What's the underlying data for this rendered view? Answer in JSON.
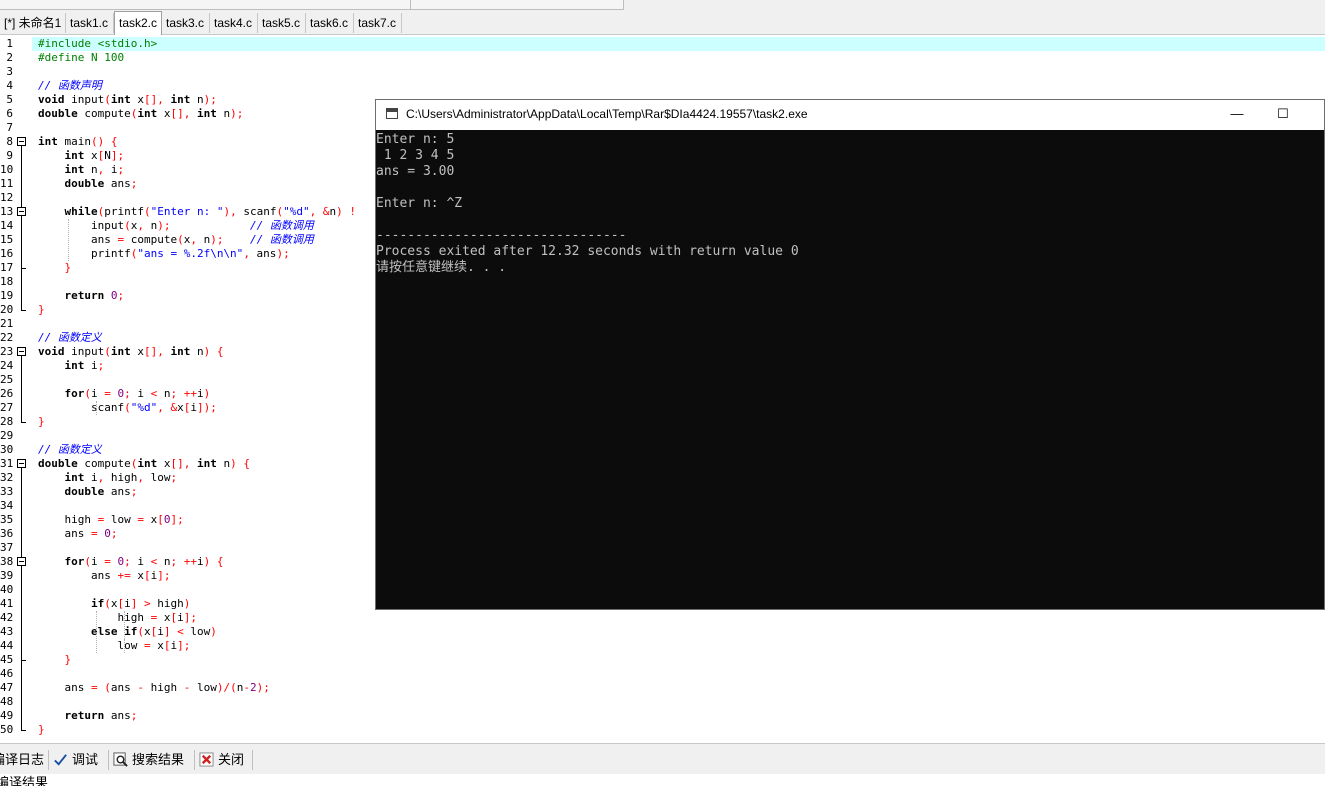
{
  "tabs": [
    "[*] 未命名1",
    "task1.c",
    "task2.c",
    "task3.c",
    "task4.c",
    "task5.c",
    "task6.c",
    "task7.c"
  ],
  "active_tab": "task2.c",
  "colors": {
    "accent_line": "#ccffff",
    "preprocessor": "#008000",
    "string": "#0000ff",
    "number": "#800080",
    "comment": "#0000ff",
    "symbol": "#ff0000"
  },
  "code": [
    "#include <stdio.h>",
    "#define N 100",
    "",
    "// 函数声明",
    "void input(int x[], int n);",
    "double compute(int x[], int n);",
    "",
    "int main() {",
    "    int x[N];",
    "    int n, i;",
    "    double ans;",
    "",
    "    while(printf(\"Enter n: \"), scanf(\"%d\", &n) !",
    "        input(x, n);            // 函数调用",
    "        ans = compute(x, n);    // 函数调用",
    "        printf(\"ans = %.2f\\n\\n\", ans);",
    "    }",
    "",
    "    return 0;",
    "}",
    "",
    "// 函数定义",
    "void input(int x[], int n) {",
    "    int i;",
    "",
    "    for(i = 0; i < n; ++i)",
    "        scanf(\"%d\", &x[i]);",
    "}",
    "",
    "// 函数定义",
    "double compute(int x[], int n) {",
    "    int i, high, low;",
    "    double ans;",
    "",
    "    high = low = x[0];",
    "    ans = 0;",
    "",
    "    for(i = 0; i < n; ++i) {",
    "        ans += x[i];",
    "",
    "        if(x[i] > high)",
    "            high = x[i];",
    "        else if(x[i] < low)",
    "            low = x[i];",
    "    }",
    "",
    "    ans = (ans - high - low)/(n-2);",
    "",
    "    return ans;",
    "}"
  ],
  "console": {
    "title": "C:\\Users\\Administrator\\AppData\\Local\\Temp\\Rar$DIa4424.19557\\task2.exe",
    "minimize": "—",
    "maximize": "☐",
    "lines": [
      "Enter n: 5",
      " 1 2 3 4 5",
      "ans = 3.00",
      "",
      "Enter n: ^Z",
      "",
      "--------------------------------",
      "Process exited after 12.32 seconds with return value 0",
      "请按任意键继续. . ."
    ]
  },
  "bottom_tabs": [
    {
      "label": "编译日志",
      "icon": "compile-log-icon"
    },
    {
      "label": "调试",
      "icon": "debug-check-icon"
    },
    {
      "label": "搜索结果",
      "icon": "search-results-icon"
    },
    {
      "label": "关闭",
      "icon": "close-icon"
    }
  ],
  "status_text": "编译结果"
}
